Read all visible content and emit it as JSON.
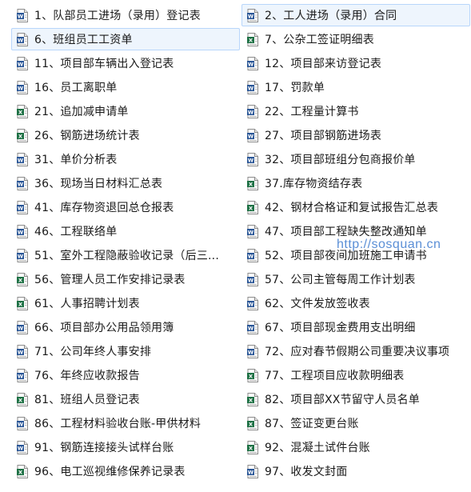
{
  "watermark": "http://sosquan.cn",
  "colors": {
    "word": "#2b5797",
    "excel": "#1e7145",
    "selected_bg": "#eef5fd",
    "selected_border": "#b8d6fb"
  },
  "items": [
    {
      "label": "1、队部员工进场（录用）登记表",
      "type": "word",
      "selected": false
    },
    {
      "label": "2、工人进场（录用）合同",
      "type": "word",
      "selected": true
    },
    {
      "label": "6、班组员工工资单",
      "type": "word",
      "selected": true
    },
    {
      "label": "7、公杂工签证明细表",
      "type": "excel",
      "selected": false
    },
    {
      "label": "11、项目部车辆出入登记表",
      "type": "word",
      "selected": false
    },
    {
      "label": "12、项目部来访登记表",
      "type": "word",
      "selected": false
    },
    {
      "label": "16、员工离职单",
      "type": "word",
      "selected": false
    },
    {
      "label": "17、罚款单",
      "type": "word",
      "selected": false
    },
    {
      "label": "21、追加减申请单",
      "type": "excel",
      "selected": false
    },
    {
      "label": "22、工程量计算书",
      "type": "word",
      "selected": false
    },
    {
      "label": "26、钢筋进场统计表",
      "type": "excel",
      "selected": false
    },
    {
      "label": "27、项目部钢筋进场表",
      "type": "word",
      "selected": false
    },
    {
      "label": "31、单价分析表",
      "type": "word",
      "selected": false
    },
    {
      "label": "32、项目部班组分包商报价单",
      "type": "word",
      "selected": false
    },
    {
      "label": "36、现场当日材料汇总表",
      "type": "word",
      "selected": false
    },
    {
      "label": "37.库存物资结存表",
      "type": "excel",
      "selected": false
    },
    {
      "label": "41、库存物资退回总仓报表",
      "type": "word",
      "selected": false
    },
    {
      "label": "42、钢材合格证和复试报告汇总表",
      "type": "excel",
      "selected": false
    },
    {
      "label": "46、工程联络单",
      "type": "word",
      "selected": false
    },
    {
      "label": "47、项目部工程缺失整改通知单",
      "type": "word",
      "selected": false
    },
    {
      "label": "51、室外工程隐蔽验收记录（后三...",
      "type": "word",
      "selected": false
    },
    {
      "label": "52、项目部夜间加班施工申请书",
      "type": "word",
      "selected": false
    },
    {
      "label": "56、管理人员工作安排记录表",
      "type": "excel",
      "selected": false
    },
    {
      "label": "57、公司主管每周工作计划表",
      "type": "word",
      "selected": false
    },
    {
      "label": "61、人事招聘计划表",
      "type": "excel",
      "selected": false
    },
    {
      "label": "62、文件发放签收表",
      "type": "word",
      "selected": false
    },
    {
      "label": "66、项目部办公用品领用簿",
      "type": "word",
      "selected": false
    },
    {
      "label": "67、项目部现金费用支出明细",
      "type": "word",
      "selected": false
    },
    {
      "label": "71、公司年终人事安排",
      "type": "word",
      "selected": false
    },
    {
      "label": "72、应对春节假期公司重要决议事项",
      "type": "word",
      "selected": false
    },
    {
      "label": "76、年终应收款报告",
      "type": "word",
      "selected": false
    },
    {
      "label": "77、工程项目应收款明细表",
      "type": "excel",
      "selected": false
    },
    {
      "label": "81、班组人员登记表",
      "type": "excel",
      "selected": false
    },
    {
      "label": "82、项目部XX节留守人员名单",
      "type": "excel",
      "selected": false
    },
    {
      "label": "86、工程材料验收台账-甲供材料",
      "type": "word",
      "selected": false
    },
    {
      "label": "87、签证变更台账",
      "type": "excel",
      "selected": false
    },
    {
      "label": "91、钢筋连接接头试样台账",
      "type": "word",
      "selected": false
    },
    {
      "label": "92、混凝土试件台账",
      "type": "excel",
      "selected": false
    },
    {
      "label": "96、电工巡视维修保养记录表",
      "type": "excel",
      "selected": false
    },
    {
      "label": "97、收发文封面",
      "type": "word",
      "selected": false
    }
  ]
}
